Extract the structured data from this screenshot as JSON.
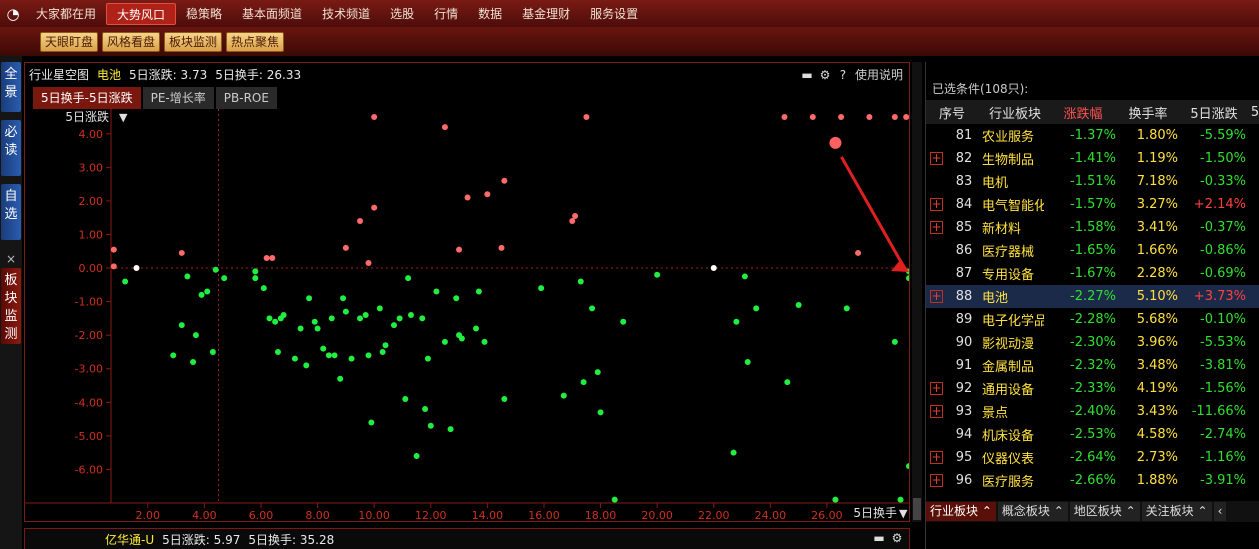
{
  "menubar": {
    "logo_icon": "app-logo-icon",
    "items": [
      "大家都在用",
      "大势风口",
      "稳策略",
      "基本面频道",
      "技术频道",
      "选股",
      "行情",
      "数据",
      "基金理财",
      "服务设置"
    ],
    "active_index": 1
  },
  "subbar": {
    "buttons": [
      "天眼盯盘",
      "风格看盘",
      "板块监测",
      "热点聚焦"
    ]
  },
  "leftnav": {
    "tabs": [
      "全景",
      "必读",
      "自选",
      "板块监测"
    ],
    "close": "×"
  },
  "chart": {
    "title": "行业星空图",
    "stock": "电池",
    "stat1_label": "5日涨跌:",
    "stat1_value": "3.73",
    "stat2_label": "5日换手:",
    "stat2_value": "26.33",
    "help": "使用说明",
    "tabs": [
      "5日换手-5日涨跌",
      "PE-增长率",
      "PB-ROE"
    ],
    "active_tab": 0
  },
  "chart_data": {
    "type": "scatter",
    "xlabel": "5日换手",
    "ylabel": "5日涨跌",
    "xlim": [
      0.7,
      28.9
    ],
    "ylim": [
      -7.0,
      4.5
    ],
    "xticks": [
      "2.00",
      "4.00",
      "6.00",
      "8.00",
      "10.00",
      "12.00",
      "14.00",
      "16.00",
      "18.00",
      "20.00",
      "22.00",
      "24.00",
      "26.00"
    ],
    "yticks": [
      "4.00",
      "3.00",
      "2.00",
      "1.00",
      "0.00",
      "-1.00",
      "-2.00",
      "-3.00",
      "-4.00",
      "-5.00",
      "-6.00"
    ],
    "crosshair": {
      "x": 4.5,
      "y": 0.0
    },
    "highlight": {
      "x": 26.3,
      "y": 3.73
    },
    "white_points": [
      [
        1.6,
        0.0
      ],
      [
        22.0,
        0.0
      ]
    ],
    "red_points": [
      [
        0.8,
        0.55
      ],
      [
        0.8,
        0.05
      ],
      [
        3.2,
        0.45
      ],
      [
        6.2,
        0.3
      ],
      [
        6.4,
        0.3
      ],
      [
        9.0,
        0.6
      ],
      [
        9.5,
        1.4
      ],
      [
        9.8,
        0.15
      ],
      [
        10.0,
        1.8
      ],
      [
        10.0,
        4.5
      ],
      [
        13.0,
        0.55
      ],
      [
        13.3,
        2.1
      ],
      [
        12.5,
        4.2
      ],
      [
        14.0,
        2.2
      ],
      [
        14.5,
        0.6
      ],
      [
        14.6,
        2.6
      ],
      [
        17.0,
        1.4
      ],
      [
        17.1,
        1.55
      ],
      [
        17.5,
        4.5
      ],
      [
        24.5,
        4.5
      ],
      [
        25.5,
        4.5
      ],
      [
        26.5,
        4.5
      ],
      [
        27.5,
        4.5
      ],
      [
        28.4,
        4.5
      ],
      [
        28.8,
        4.5
      ],
      [
        27.1,
        0.45
      ]
    ],
    "green_points": [
      [
        1.2,
        -0.4
      ],
      [
        2.9,
        -2.6
      ],
      [
        3.2,
        -1.7
      ],
      [
        3.4,
        -0.25
      ],
      [
        3.6,
        -2.8
      ],
      [
        3.7,
        -2.0
      ],
      [
        3.9,
        -0.8
      ],
      [
        4.1,
        -0.7
      ],
      [
        4.3,
        -2.5
      ],
      [
        4.4,
        -0.05
      ],
      [
        4.7,
        -0.3
      ],
      [
        5.8,
        -0.1
      ],
      [
        5.8,
        -0.3
      ],
      [
        6.1,
        -0.6
      ],
      [
        6.3,
        -1.5
      ],
      [
        6.5,
        -1.6
      ],
      [
        6.6,
        -2.5
      ],
      [
        6.7,
        -1.5
      ],
      [
        6.8,
        -1.4
      ],
      [
        7.2,
        -2.7
      ],
      [
        7.4,
        -1.8
      ],
      [
        7.6,
        -2.9
      ],
      [
        7.7,
        -0.9
      ],
      [
        7.9,
        -1.6
      ],
      [
        8.0,
        -1.8
      ],
      [
        8.2,
        -2.4
      ],
      [
        8.4,
        -2.6
      ],
      [
        8.5,
        -1.5
      ],
      [
        8.6,
        -2.6
      ],
      [
        8.8,
        -3.3
      ],
      [
        8.9,
        -0.9
      ],
      [
        9.0,
        -1.3
      ],
      [
        9.2,
        -2.7
      ],
      [
        9.5,
        -1.5
      ],
      [
        9.7,
        -1.4
      ],
      [
        9.8,
        -2.6
      ],
      [
        9.9,
        -4.6
      ],
      [
        10.2,
        -1.2
      ],
      [
        10.3,
        -2.5
      ],
      [
        10.4,
        -2.3
      ],
      [
        10.7,
        -1.7
      ],
      [
        10.9,
        -1.5
      ],
      [
        11.1,
        -3.9
      ],
      [
        11.2,
        -0.3
      ],
      [
        11.3,
        -1.4
      ],
      [
        11.5,
        -5.6
      ],
      [
        11.7,
        -1.5
      ],
      [
        11.8,
        -4.2
      ],
      [
        11.9,
        -2.7
      ],
      [
        12.0,
        -4.7
      ],
      [
        12.2,
        -0.7
      ],
      [
        12.5,
        -2.2
      ],
      [
        12.7,
        -4.8
      ],
      [
        12.9,
        -0.9
      ],
      [
        13.0,
        -2.0
      ],
      [
        13.1,
        -2.1
      ],
      [
        13.6,
        -1.8
      ],
      [
        13.7,
        -0.7
      ],
      [
        13.9,
        -2.2
      ],
      [
        14.6,
        -3.9
      ],
      [
        15.9,
        -0.6
      ],
      [
        16.7,
        -3.8
      ],
      [
        17.3,
        -0.4
      ],
      [
        17.4,
        -3.4
      ],
      [
        17.7,
        -1.2
      ],
      [
        17.9,
        -3.1
      ],
      [
        18.0,
        -4.3
      ],
      [
        18.5,
        -6.9
      ],
      [
        18.8,
        -1.6
      ],
      [
        20.0,
        -0.2
      ],
      [
        22.7,
        -5.5
      ],
      [
        22.8,
        -1.6
      ],
      [
        23.1,
        -0.25
      ],
      [
        23.2,
        -2.8
      ],
      [
        23.5,
        -1.2
      ],
      [
        24.6,
        -3.4
      ],
      [
        25.0,
        -1.1
      ],
      [
        26.3,
        -6.9
      ],
      [
        26.7,
        -1.2
      ],
      [
        28.4,
        -2.2
      ],
      [
        28.6,
        -6.9
      ],
      [
        28.9,
        -0.1
      ],
      [
        28.9,
        -0.3
      ],
      [
        28.9,
        -5.9
      ]
    ]
  },
  "bottom_panel": {
    "stock": "亿华通-U",
    "stat1_label": "5日涨跌:",
    "stat1_value": "5.97",
    "stat2_label": "5日换手:",
    "stat2_value": "35.28"
  },
  "rightpanel": {
    "condition": "已选条件(108只):",
    "headers": [
      "序号",
      "行业板块",
      "涨跌幅",
      "换手率",
      "5日涨跌",
      "5"
    ],
    "rows": [
      {
        "plus": false,
        "no": "81",
        "name": "农业服务",
        "chg": "-1.37%",
        "turn": "1.80%",
        "d5": "-5.59%",
        "up": false
      },
      {
        "plus": true,
        "no": "82",
        "name": "生物制品",
        "chg": "-1.41%",
        "turn": "1.19%",
        "d5": "-1.50%",
        "up": false
      },
      {
        "plus": false,
        "no": "83",
        "name": "电机",
        "chg": "-1.51%",
        "turn": "7.18%",
        "d5": "-0.33%",
        "up": false
      },
      {
        "plus": true,
        "no": "84",
        "name": "电气智能化",
        "chg": "-1.57%",
        "turn": "3.27%",
        "d5": "+2.14%",
        "up": true
      },
      {
        "plus": true,
        "no": "85",
        "name": "新材料",
        "chg": "-1.58%",
        "turn": "3.41%",
        "d5": "-0.37%",
        "up": false
      },
      {
        "plus": false,
        "no": "86",
        "name": "医疗器械",
        "chg": "-1.65%",
        "turn": "1.66%",
        "d5": "-0.86%",
        "up": false
      },
      {
        "plus": false,
        "no": "87",
        "name": "专用设备",
        "chg": "-1.67%",
        "turn": "2.28%",
        "d5": "-0.69%",
        "up": false
      },
      {
        "plus": true,
        "no": "88",
        "name": "电池",
        "chg": "-2.27%",
        "turn": "5.10%",
        "d5": "+3.73%",
        "up": true,
        "selected": true
      },
      {
        "plus": false,
        "no": "89",
        "name": "电子化学品",
        "chg": "-2.28%",
        "turn": "5.68%",
        "d5": "-0.10%",
        "up": false
      },
      {
        "plus": false,
        "no": "90",
        "name": "影视动漫",
        "chg": "-2.30%",
        "turn": "3.96%",
        "d5": "-5.53%",
        "up": false
      },
      {
        "plus": false,
        "no": "91",
        "name": "金属制品",
        "chg": "-2.32%",
        "turn": "3.48%",
        "d5": "-3.81%",
        "up": false
      },
      {
        "plus": true,
        "no": "92",
        "name": "通用设备",
        "chg": "-2.33%",
        "turn": "4.19%",
        "d5": "-1.56%",
        "up": false
      },
      {
        "plus": true,
        "no": "93",
        "name": "景点",
        "chg": "-2.40%",
        "turn": "3.43%",
        "d5": "-11.66%",
        "up": false
      },
      {
        "plus": false,
        "no": "94",
        "name": "机床设备",
        "chg": "-2.53%",
        "turn": "4.58%",
        "d5": "-2.74%",
        "up": false
      },
      {
        "plus": true,
        "no": "95",
        "name": "仪器仪表",
        "chg": "-2.64%",
        "turn": "2.73%",
        "d5": "-1.16%",
        "up": false
      },
      {
        "plus": true,
        "no": "96",
        "name": "医疗服务",
        "chg": "-2.66%",
        "turn": "1.88%",
        "d5": "-3.91%",
        "up": false
      }
    ],
    "bottom_tabs": [
      "行业板块",
      "概念板块",
      "地区板块",
      "关注板块"
    ],
    "condition2": "已选条件(108只):"
  },
  "colors": {
    "red_point": "#ff6a6a",
    "green_point": "#20ee40",
    "white_point": "#ffffff",
    "arrow": "#e02020",
    "axis": "#8a1a14"
  }
}
